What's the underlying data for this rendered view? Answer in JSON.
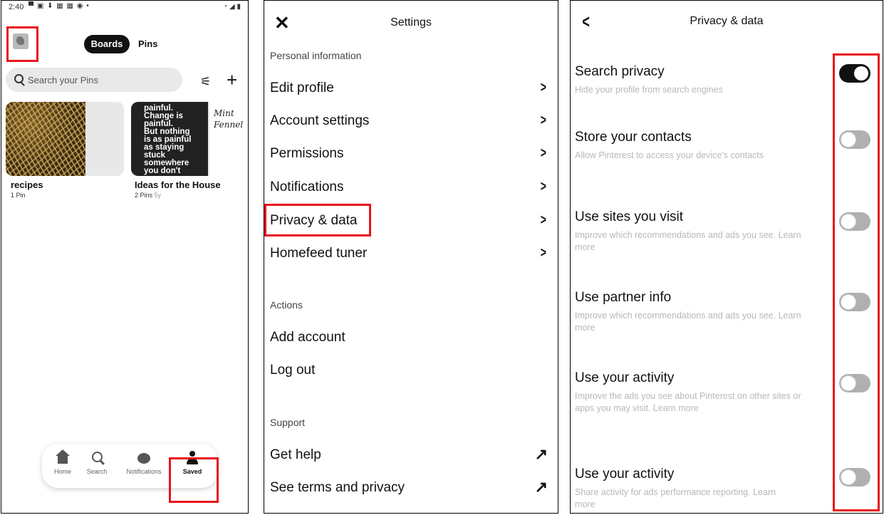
{
  "saved_screen": {
    "status_time": "2:40",
    "tabs": {
      "boards": "Boards",
      "pins": "Pins"
    },
    "search_placeholder": "Search your Pins",
    "boards": [
      {
        "name": "recipes",
        "meta": "1 Pin",
        "age": ""
      },
      {
        "name": "Ideas for the House",
        "meta": "2 Pins",
        "age": "5y"
      }
    ],
    "board2_image_text": [
      "painful.",
      "Change is",
      "painful.",
      "But nothing",
      "is as painful",
      "as staying",
      "stuck",
      "somewhere",
      "you don't"
    ],
    "board2_side_text": [
      "Mint",
      "Fennel"
    ],
    "nav": [
      {
        "label": "Home",
        "icon": "home-icon"
      },
      {
        "label": "Search",
        "icon": "search-icon"
      },
      {
        "label": "Notifications",
        "icon": "notifications-icon"
      },
      {
        "label": "Saved",
        "icon": "profile-icon"
      }
    ]
  },
  "settings_screen": {
    "title": "Settings",
    "sections": {
      "personal": "Personal information",
      "actions": "Actions",
      "support": "Support"
    },
    "personal_items": [
      "Edit profile",
      "Account settings",
      "Permissions",
      "Notifications",
      "Privacy & data",
      "Homefeed tuner"
    ],
    "action_items": [
      "Add account",
      "Log out"
    ],
    "support_items": [
      "Get help",
      "See terms and privacy"
    ]
  },
  "privacy_screen": {
    "title": "Privacy & data",
    "settings": [
      {
        "title": "Search privacy",
        "desc": "Hide your profile from search engines",
        "on": true
      },
      {
        "title": "Store your contacts",
        "desc": "Allow Pinterest to access your device's contacts",
        "on": false
      },
      {
        "title": "Use sites you visit",
        "desc": "Improve which recommendations and ads you see. Learn more",
        "on": false
      },
      {
        "title": "Use partner info",
        "desc": "Improve which recommendations and ads you see. Learn more",
        "on": false
      },
      {
        "title": "Use your activity",
        "desc": "Improve the ads you see about Pinterest on other sites or apps you may visit. Learn more",
        "on": false
      },
      {
        "title": "Use your activity",
        "desc": "Share activity for ads performance reporting. Learn more",
        "on": false
      }
    ]
  },
  "highlight_color": "#e8141c"
}
